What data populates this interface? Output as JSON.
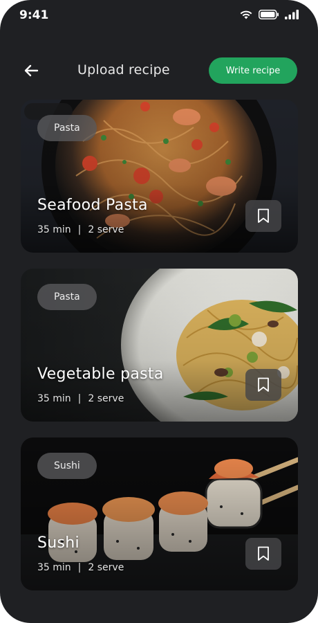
{
  "status_bar": {
    "time": "9:41"
  },
  "header": {
    "title": "Upload recipe",
    "write_button_label": "Write recipe",
    "back_icon": "arrow-left-icon"
  },
  "colors": {
    "background": "#1f2023",
    "accent": "#22a45d",
    "pill_bg": "#5a5a5c",
    "bookmark_bg": "#464648"
  },
  "recipes": [
    {
      "category": "Pasta",
      "title": "Seafood Pasta",
      "time": "35 min",
      "separator": "|",
      "serves": "2 serve",
      "bookmark_icon": "bookmark-icon"
    },
    {
      "category": "Pasta",
      "title": "Vegetable pasta",
      "time": "35 min",
      "separator": "|",
      "serves": "2 serve",
      "bookmark_icon": "bookmark-icon"
    },
    {
      "category": "Sushi",
      "title": "Sushi",
      "time": "35 min",
      "separator": "|",
      "serves": "2 serve",
      "bookmark_icon": "bookmark-icon"
    }
  ]
}
